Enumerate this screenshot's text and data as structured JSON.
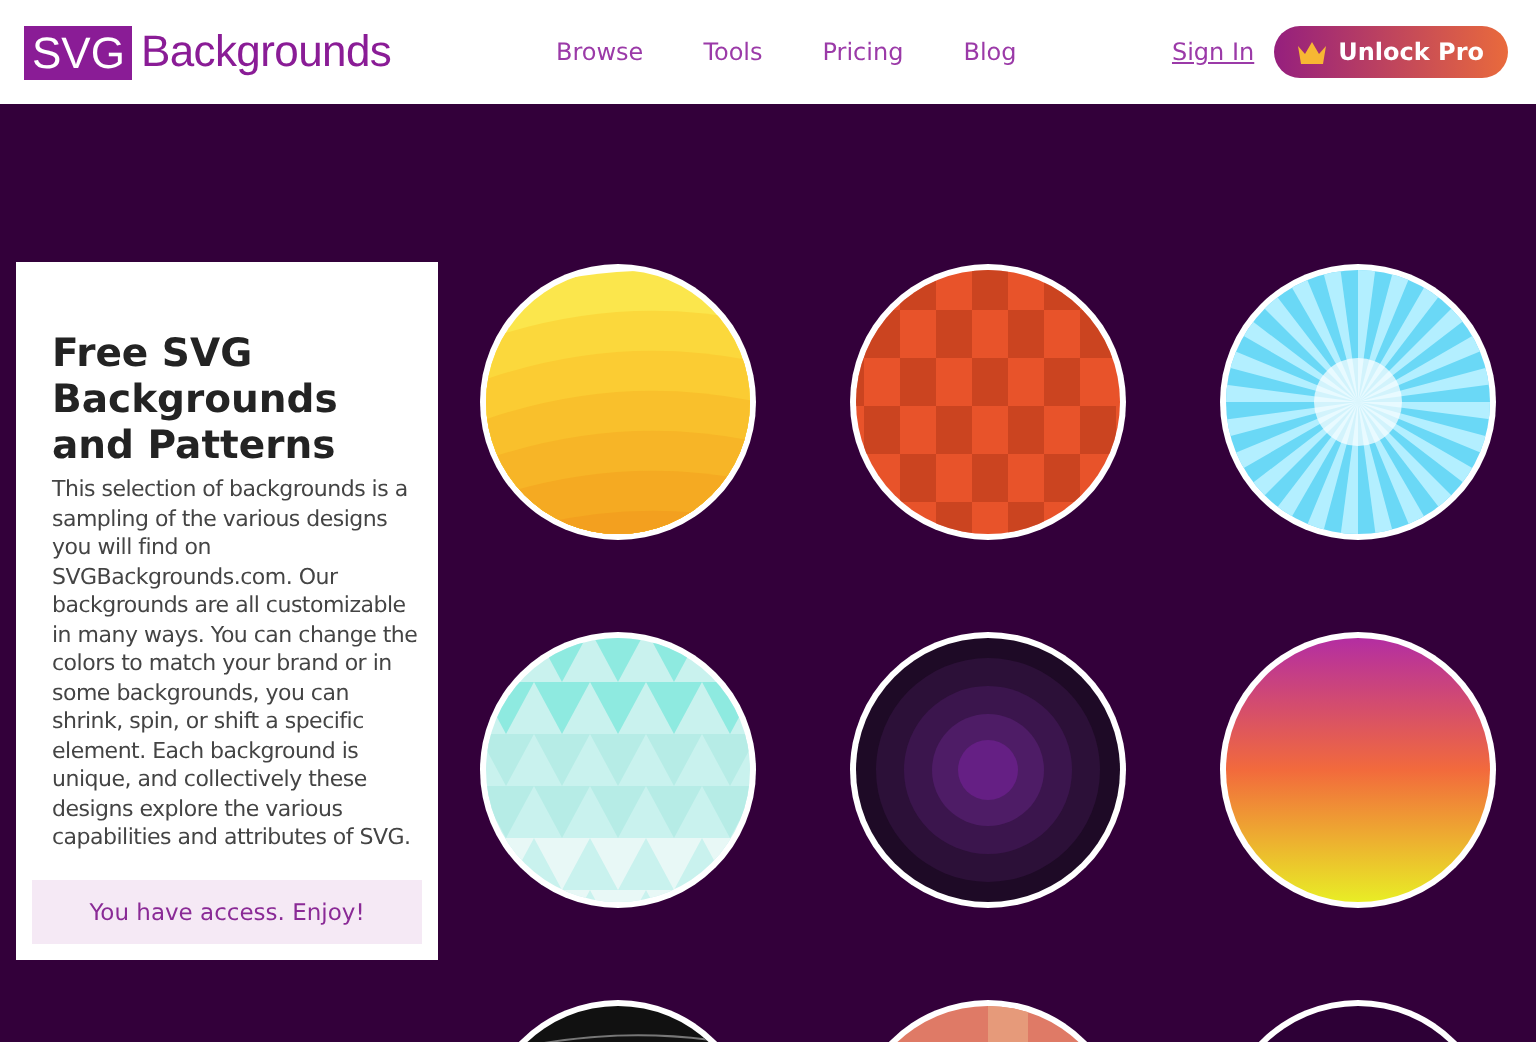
{
  "header": {
    "logo": {
      "mark": "SVG",
      "name": "Backgrounds"
    },
    "nav": [
      "Browse",
      "Tools",
      "Pricing",
      "Blog"
    ],
    "sign_in": "Sign In",
    "cta": "Unlock Pro"
  },
  "intro": {
    "title": "Free SVG Backgrounds and Patterns",
    "body": "This selection of backgrounds is a sampling of the various designs you will find on SVGBackgrounds.com. Our backgrounds are all customizable in many ways. You can change the colors to match your brand or in some backgrounds, you can shrink, spin, or shift a specific element. Each background is unique, and collectively these designs explore the various capabilities and attributes of SVG.",
    "notice": "You have access. Enjoy!"
  },
  "backgrounds": [
    {
      "kind": "waves"
    },
    {
      "kind": "tiles"
    },
    {
      "kind": "burst"
    },
    {
      "kind": "triangles"
    },
    {
      "kind": "rings"
    },
    {
      "kind": "gradient"
    },
    {
      "kind": "lines"
    },
    {
      "kind": "stripes"
    },
    {
      "kind": "dark"
    }
  ]
}
